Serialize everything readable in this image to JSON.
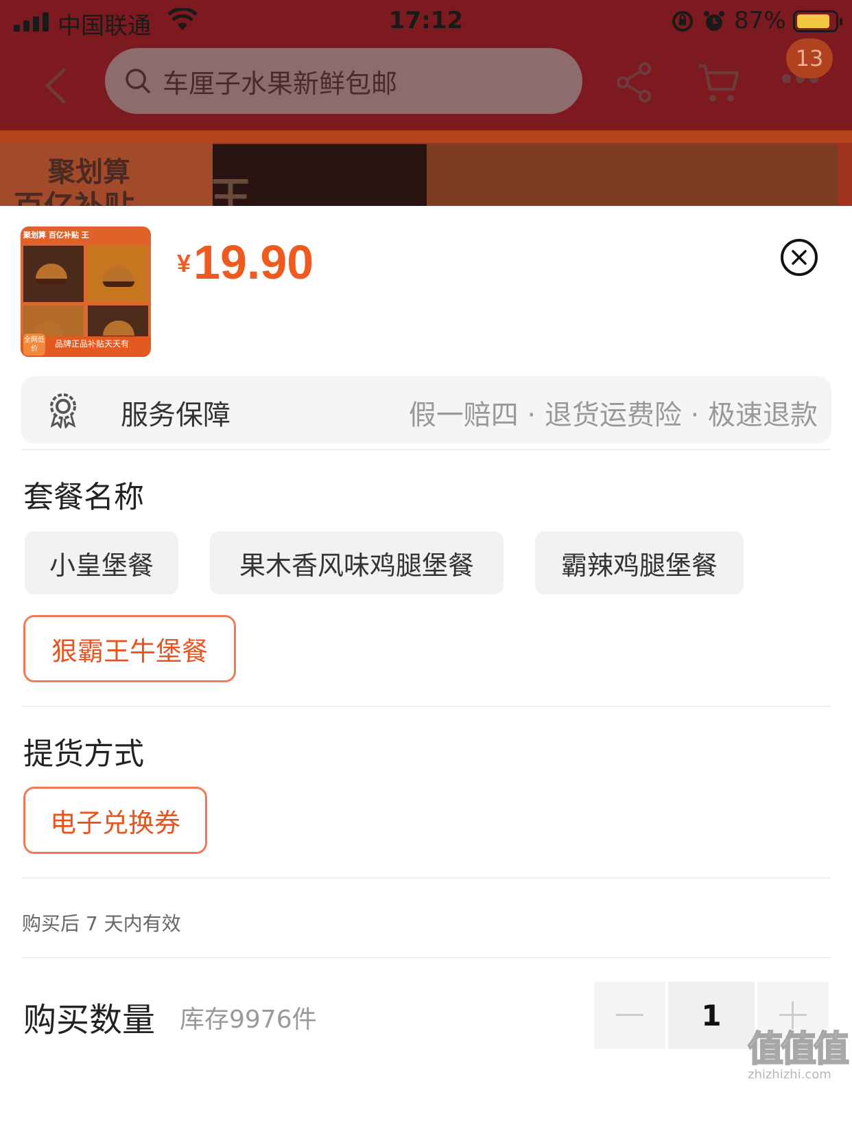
{
  "status_bar": {
    "carrier": "中国联通",
    "time": "17:12",
    "battery_percent": "87%",
    "battery_level": 0.87,
    "battery_color": "#f4c542"
  },
  "nav": {
    "search_placeholder": "车厘子水果新鲜包邮",
    "cart_badge": "13",
    "icons": [
      "chevron-left-icon",
      "search-icon",
      "share-icon",
      "cart-icon",
      "more-icon"
    ]
  },
  "banner": {
    "brand_line1": "聚划算",
    "brand_line2": "百亿补贴",
    "cropped_char": "王"
  },
  "product": {
    "thumbnail": {
      "header": "聚划算 百亿补贴 王",
      "badge": "全网低价",
      "footer": "品牌正品补贴天天有"
    },
    "currency": "¥",
    "price": "19.90",
    "accent_color": "#f05a1f"
  },
  "service": {
    "label": "服务保障",
    "detail": "假一赔四 · 退货运费险 · 极速退款"
  },
  "package_section": {
    "title": "套餐名称",
    "options": [
      {
        "label": "小皇堡餐",
        "selected": false
      },
      {
        "label": "果木香风味鸡腿堡餐",
        "selected": false
      },
      {
        "label": "霸辣鸡腿堡餐",
        "selected": false
      },
      {
        "label": "狠霸王牛堡餐",
        "selected": true
      }
    ]
  },
  "pickup_section": {
    "title": "提货方式",
    "options": [
      {
        "label": "电子兑换券",
        "selected": true
      }
    ]
  },
  "validity": "购买后 7 天内有效",
  "quantity": {
    "title": "购买数量",
    "stock": "库存9976件",
    "value": "1"
  },
  "watermark": {
    "mark": "值值值",
    "domain": "zhizhizhi.com"
  }
}
